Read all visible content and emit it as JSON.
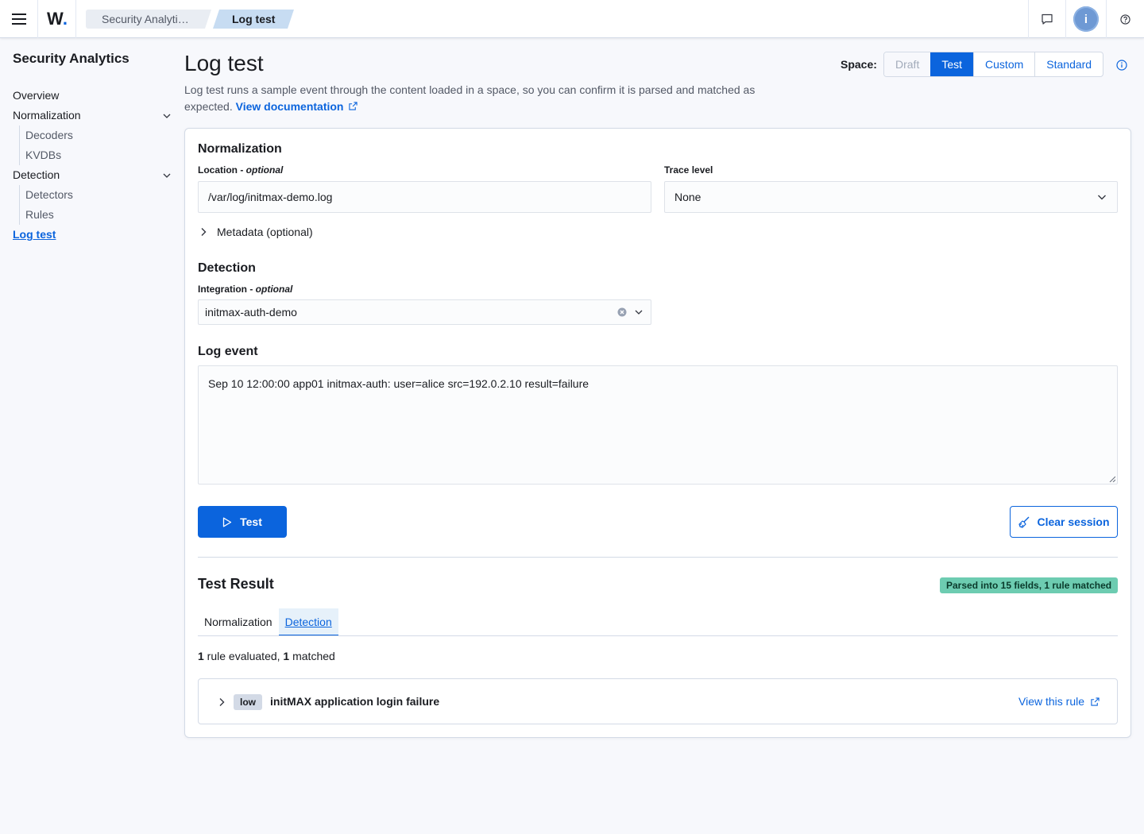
{
  "header": {
    "logo_text": "W",
    "breadcrumbs": [
      "Security Analyti…",
      "Log test"
    ],
    "avatar_initial": "i",
    "icons": [
      "menu-icon",
      "chat-icon",
      "help-icon"
    ]
  },
  "sidebar": {
    "title": "Security Analytics",
    "items": [
      {
        "label": "Overview"
      },
      {
        "label": "Normalization",
        "children": [
          "Decoders",
          "KVDBs"
        ]
      },
      {
        "label": "Detection",
        "children": [
          "Detectors",
          "Rules"
        ]
      },
      {
        "label": "Log test",
        "active": true
      }
    ]
  },
  "page": {
    "title": "Log test",
    "description": "Log test runs a sample event through the content loaded in a space, so you can confirm it is parsed and matched as expected.",
    "doc_link": "View documentation",
    "space_label": "Space:",
    "spaces": [
      "Draft",
      "Test",
      "Custom",
      "Standard"
    ],
    "active_space": "Test"
  },
  "normalization": {
    "heading": "Normalization",
    "location_label": "Location - ",
    "location_optional": "optional",
    "location_value": "/var/log/initmax-demo.log",
    "trace_label": "Trace level",
    "trace_value": "None",
    "metadata_toggle": "Metadata (optional)"
  },
  "detection": {
    "heading": "Detection",
    "integration_label": "Integration - ",
    "integration_optional": "optional",
    "integration_value": "initmax-auth-demo"
  },
  "log_event": {
    "heading": "Log event",
    "value": "Sep 10 12:00:00 app01 initmax-auth: user=alice src=192.0.2.10 result=failure"
  },
  "actions": {
    "test_label": "Test",
    "clear_label": "Clear session"
  },
  "result": {
    "title": "Test Result",
    "badge": "Parsed into 15 fields, 1 rule matched",
    "tabs": [
      "Normalization",
      "Detection"
    ],
    "active_tab": "Detection",
    "evaluated_count": "1",
    "evaluated_text": " rule evaluated, ",
    "matched_count": "1",
    "matched_text": " matched",
    "rules": [
      {
        "severity": "low",
        "name": "initMAX application login failure",
        "link": "View this rule"
      }
    ]
  },
  "colors": {
    "accent": "#0b64dd",
    "success_badge": "#6dccb1",
    "border": "#d3dae6"
  }
}
